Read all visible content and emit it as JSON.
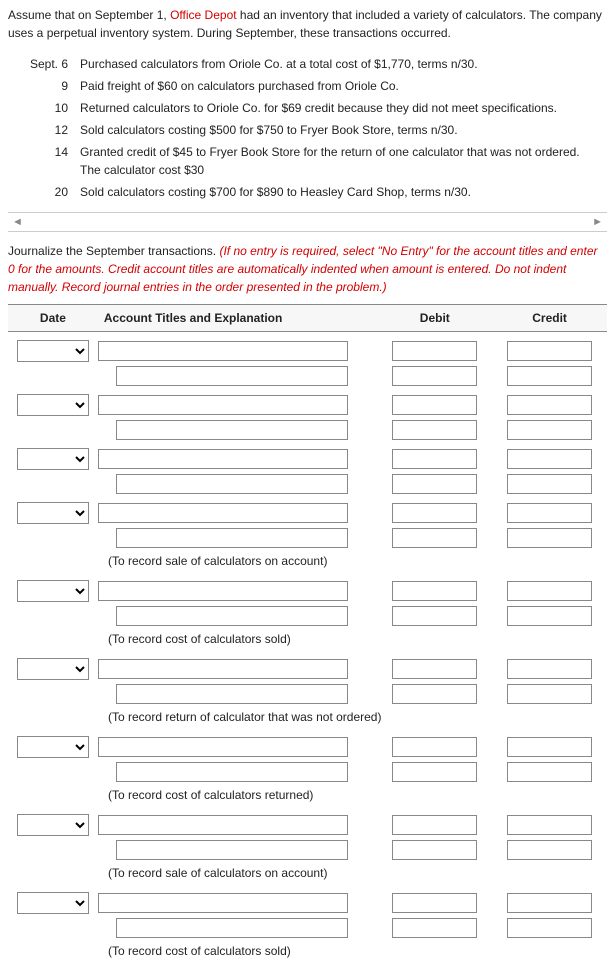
{
  "intro": {
    "pre": "Assume that on September 1, ",
    "company": "Office Depot",
    "post": " had an inventory that included a variety of calculators. The company uses a perpetual inventory system. During September, these transactions occurred."
  },
  "transactions": [
    {
      "date": "Sept. 6",
      "text": "Purchased calculators from Oriole Co. at a total cost of $1,770, terms n/30."
    },
    {
      "date": "9",
      "text": "Paid freight of $60 on calculators purchased from Oriole Co."
    },
    {
      "date": "10",
      "text": "Returned calculators to Oriole Co. for $69 credit because they did not meet specifications."
    },
    {
      "date": "12",
      "text": "Sold calculators costing $500 for $750 to Fryer Book Store, terms n/30."
    },
    {
      "date": "14",
      "text": "Granted credit of $45 to Fryer Book Store for the return of one calculator that was not ordered. The calculator cost $30"
    },
    {
      "date": "20",
      "text": "Sold calculators costing $700 for $890 to Heasley Card Shop, terms n/30."
    }
  ],
  "scroll": {
    "left": "◄",
    "right": "►"
  },
  "instructions": {
    "lead": "Journalize the September transactions. ",
    "red": "(If no entry is required, select \"No Entry\" for the account titles and enter 0 for the amounts. Credit account titles are automatically indented when amount is entered. Do not indent manually. Record journal entries in the order presented in the problem.)"
  },
  "headers": {
    "date": "Date",
    "acct": "Account Titles and Explanation",
    "debit": "Debit",
    "credit": "Credit"
  },
  "notes": {
    "sale": "(To record sale of calculators on account)",
    "cost_sold": "(To record cost of calculators sold)",
    "return_not_ordered": "(To record return of calculator that was not ordered)",
    "cost_returned": "(To record cost of calculators returned)"
  }
}
